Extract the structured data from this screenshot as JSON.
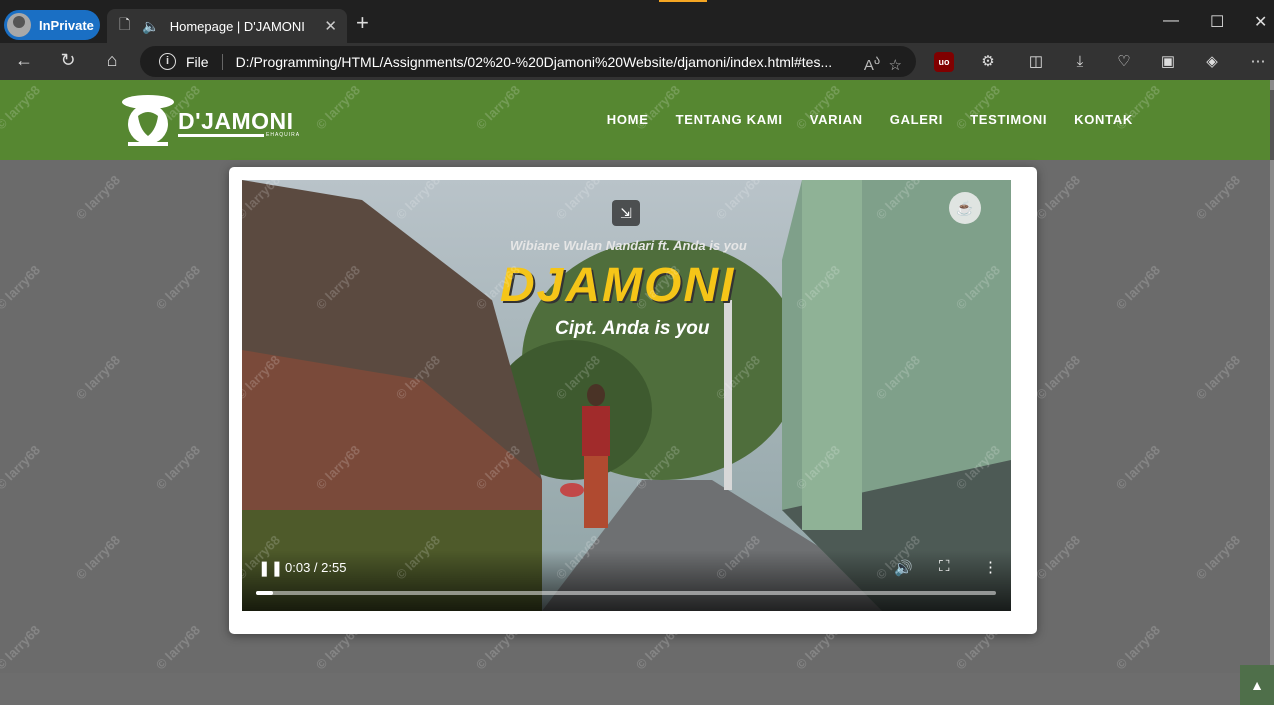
{
  "browser": {
    "inprivate_label": "InPrivate",
    "tab_title": "Homepage | D'JAMONI",
    "address_scheme": "File",
    "address_url": "D:/Programming/HTML/Assignments/02%20-%20Djamoni%20Website/djamoni/index.html#tes..."
  },
  "site": {
    "brand": "D'JAMONI",
    "brand_sub": "EHAQUIRA",
    "nav": [
      "HOME",
      "TENTANG KAMI",
      "VARIAN",
      "GALERI",
      "TESTIMONI",
      "KONTAK"
    ]
  },
  "video": {
    "overlay_top": "Wibiane Wulan Nandari ft. Anda is you",
    "overlay_title": "DJAMONI",
    "overlay_sub": "Cipt. Anda is you",
    "time": "0:03 / 2:55",
    "progress": 0.023
  },
  "watermark": "© larry68",
  "colors": {
    "header": "#568731",
    "title_yellow": "#f5c518"
  }
}
